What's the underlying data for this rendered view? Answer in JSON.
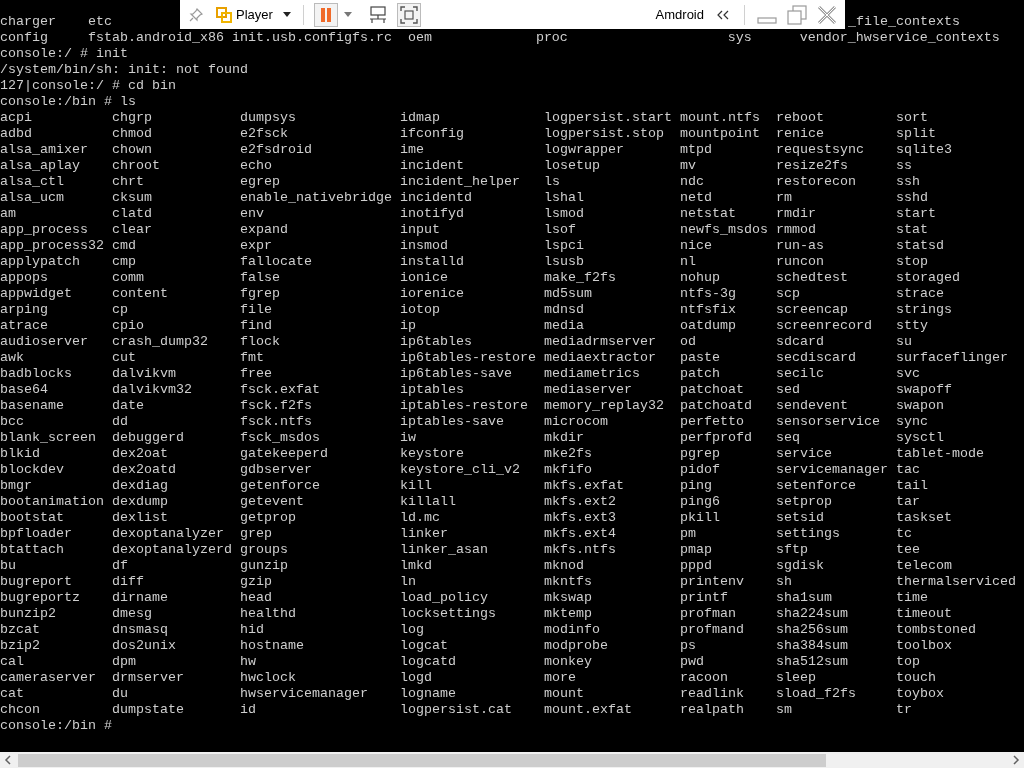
{
  "toolbar": {
    "menu_label": "Player",
    "title": "Amdroid"
  },
  "terminal": {
    "partial_line": {
      "left": "charger    etc",
      "right": "_file_contexts"
    },
    "lines": [
      "config     fstab.android_x86 init.usb.configfs.rc  oem             proc                    sys      vendor_hwservice_contexts",
      "console:/ # init",
      "/system/bin/sh: init: not found",
      "127|console:/ # cd bin",
      "console:/bin # ls"
    ],
    "listing": {
      "columns": [
        [
          "acpi",
          "adbd",
          "alsa_amixer",
          "alsa_aplay",
          "alsa_ctl",
          "alsa_ucm",
          "am",
          "app_process",
          "app_process32",
          "applypatch",
          "appops",
          "appwidget",
          "arping",
          "atrace",
          "audioserver",
          "awk",
          "badblocks",
          "base64",
          "basename",
          "bcc",
          "blank_screen",
          "blkid",
          "blockdev",
          "bmgr",
          "bootanimation",
          "bootstat",
          "bpfloader",
          "btattach",
          "bu",
          "bugreport",
          "bugreportz",
          "bunzip2",
          "bzcat",
          "bzip2",
          "cal",
          "cameraserver",
          "cat",
          "chcon"
        ],
        [
          "chgrp",
          "chmod",
          "chown",
          "chroot",
          "chrt",
          "cksum",
          "clatd",
          "clear",
          "cmd",
          "cmp",
          "comm",
          "content",
          "cp",
          "cpio",
          "crash_dump32",
          "cut",
          "dalvikvm",
          "dalvikvm32",
          "date",
          "dd",
          "debuggerd",
          "dex2oat",
          "dex2oatd",
          "dexdiag",
          "dexdump",
          "dexlist",
          "dexoptanalyzer",
          "dexoptanalyzerd",
          "df",
          "diff",
          "dirname",
          "dmesg",
          "dnsmasq",
          "dos2unix",
          "dpm",
          "drmserver",
          "du",
          "dumpstate"
        ],
        [
          "dumpsys",
          "e2fsck",
          "e2fsdroid",
          "echo",
          "egrep",
          "enable_nativebridge",
          "env",
          "expand",
          "expr",
          "fallocate",
          "false",
          "fgrep",
          "file",
          "find",
          "flock",
          "fmt",
          "free",
          "fsck.exfat",
          "fsck.f2fs",
          "fsck.ntfs",
          "fsck_msdos",
          "gatekeeperd",
          "gdbserver",
          "getenforce",
          "getevent",
          "getprop",
          "grep",
          "groups",
          "gunzip",
          "gzip",
          "head",
          "healthd",
          "hid",
          "hostname",
          "hw",
          "hwclock",
          "hwservicemanager",
          "id"
        ],
        [
          "idmap",
          "ifconfig",
          "ime",
          "incident",
          "incident_helper",
          "incidentd",
          "inotifyd",
          "input",
          "insmod",
          "installd",
          "ionice",
          "iorenice",
          "iotop",
          "ip",
          "ip6tables",
          "ip6tables-restore",
          "ip6tables-save",
          "iptables",
          "iptables-restore",
          "iptables-save",
          "iw",
          "keystore",
          "keystore_cli_v2",
          "kill",
          "killall",
          "ld.mc",
          "linker",
          "linker_asan",
          "lmkd",
          "ln",
          "load_policy",
          "locksettings",
          "log",
          "logcat",
          "logcatd",
          "logd",
          "logname",
          "logpersist.cat"
        ],
        [
          "logpersist.start",
          "logpersist.stop",
          "logwrapper",
          "losetup",
          "ls",
          "lshal",
          "lsmod",
          "lsof",
          "lspci",
          "lsusb",
          "make_f2fs",
          "md5sum",
          "mdnsd",
          "media",
          "mediadrmserver",
          "mediaextractor",
          "mediametrics",
          "mediaserver",
          "memory_replay32",
          "microcom",
          "mkdir",
          "mke2fs",
          "mkfifo",
          "mkfs.exfat",
          "mkfs.ext2",
          "mkfs.ext3",
          "mkfs.ext4",
          "mkfs.ntfs",
          "mknod",
          "mkntfs",
          "mkswap",
          "mktemp",
          "modinfo",
          "modprobe",
          "monkey",
          "more",
          "mount",
          "mount.exfat"
        ],
        [
          "mount.ntfs",
          "mountpoint",
          "mtpd",
          "mv",
          "ndc",
          "netd",
          "netstat",
          "newfs_msdos",
          "nice",
          "nl",
          "nohup",
          "ntfs-3g",
          "ntfsfix",
          "oatdump",
          "od",
          "paste",
          "patch",
          "patchoat",
          "patchoatd",
          "perfetto",
          "perfprofd",
          "pgrep",
          "pidof",
          "ping",
          "ping6",
          "pkill",
          "pm",
          "pmap",
          "pppd",
          "printenv",
          "printf",
          "profman",
          "profmand",
          "ps",
          "pwd",
          "racoon",
          "readlink",
          "realpath"
        ],
        [
          "reboot",
          "renice",
          "requestsync",
          "resize2fs",
          "restorecon",
          "rm",
          "rmdir",
          "rmmod",
          "run-as",
          "runcon",
          "schedtest",
          "scp",
          "screencap",
          "screenrecord",
          "sdcard",
          "secdiscard",
          "secilc",
          "sed",
          "sendevent",
          "sensorservice",
          "seq",
          "service",
          "servicemanager",
          "setenforce",
          "setprop",
          "setsid",
          "settings",
          "sftp",
          "sgdisk",
          "sh",
          "sha1sum",
          "sha224sum",
          "sha256sum",
          "sha384sum",
          "sha512sum",
          "sleep",
          "sload_f2fs",
          "sm"
        ],
        [
          "sort",
          "split",
          "sqlite3",
          "ss",
          "ssh",
          "sshd",
          "start",
          "stat",
          "statsd",
          "stop",
          "storaged",
          "strace",
          "strings",
          "stty",
          "su",
          "surfaceflinger",
          "svc",
          "swapoff",
          "swapon",
          "sync",
          "sysctl",
          "tablet-mode",
          "tac",
          "tail",
          "tar",
          "taskset",
          "tc",
          "tee",
          "telecom",
          "thermalserviced",
          "time",
          "timeout",
          "tombstoned",
          "toolbox",
          "top",
          "touch",
          "toybox",
          "tr"
        ]
      ]
    },
    "prompt": "console:/bin #"
  }
}
